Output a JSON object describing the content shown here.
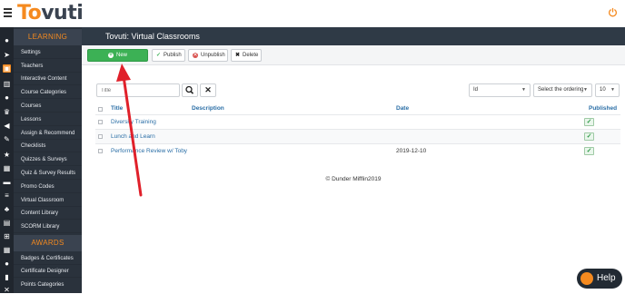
{
  "app": {
    "logo_part1": "To",
    "logo_part2": "vuti"
  },
  "sidebar": {
    "section_learning": "LEARNING",
    "items": [
      {
        "label": "Settings"
      },
      {
        "label": "Teachers"
      },
      {
        "label": "Interactive Content"
      },
      {
        "label": "Course Categories"
      },
      {
        "label": "Courses"
      },
      {
        "label": "Lessons"
      },
      {
        "label": "Assign & Recommend"
      },
      {
        "label": "Checklists"
      },
      {
        "label": "Quizzes & Surveys"
      },
      {
        "label": "Quiz & Survey Results"
      },
      {
        "label": "Promo Codes"
      },
      {
        "label": "Virtual Classroom"
      },
      {
        "label": "Content Library"
      },
      {
        "label": "SCORM Library"
      }
    ],
    "section_awards": "AWARDS",
    "award_items": [
      {
        "label": "Badges & Certificates"
      },
      {
        "label": "Certificate Designer"
      },
      {
        "label": "Points Categories"
      }
    ]
  },
  "page": {
    "title": "Tovuti: Virtual Classrooms"
  },
  "toolbar": {
    "new_label": "New",
    "publish_label": "Publish",
    "unpublish_label": "Unpublish",
    "delete_label": "Delete"
  },
  "filters": {
    "search_placeholder": "Title",
    "sort_field": "Id",
    "ordering": "Select the ordering",
    "limit": "10"
  },
  "table": {
    "headers": {
      "title": "Title",
      "description": "Description",
      "date": "Date",
      "published": "Published"
    },
    "rows": [
      {
        "title": "Diversity Training",
        "description": "",
        "date": "",
        "published": true
      },
      {
        "title": "Lunch and Learn",
        "description": "",
        "date": "",
        "published": true
      },
      {
        "title": "Performance Review w/ Toby",
        "description": "",
        "date": "2019-12-10",
        "published": true
      }
    ]
  },
  "footer": {
    "copyright": "© Dunder Mifflin2019"
  },
  "help": {
    "label": "Help"
  },
  "colors": {
    "accent": "#f58a1f",
    "new_button": "#3cb155",
    "link": "#2a6ea6",
    "sidebar": "#2a323c",
    "annotation_arrow": "#e0202a"
  }
}
